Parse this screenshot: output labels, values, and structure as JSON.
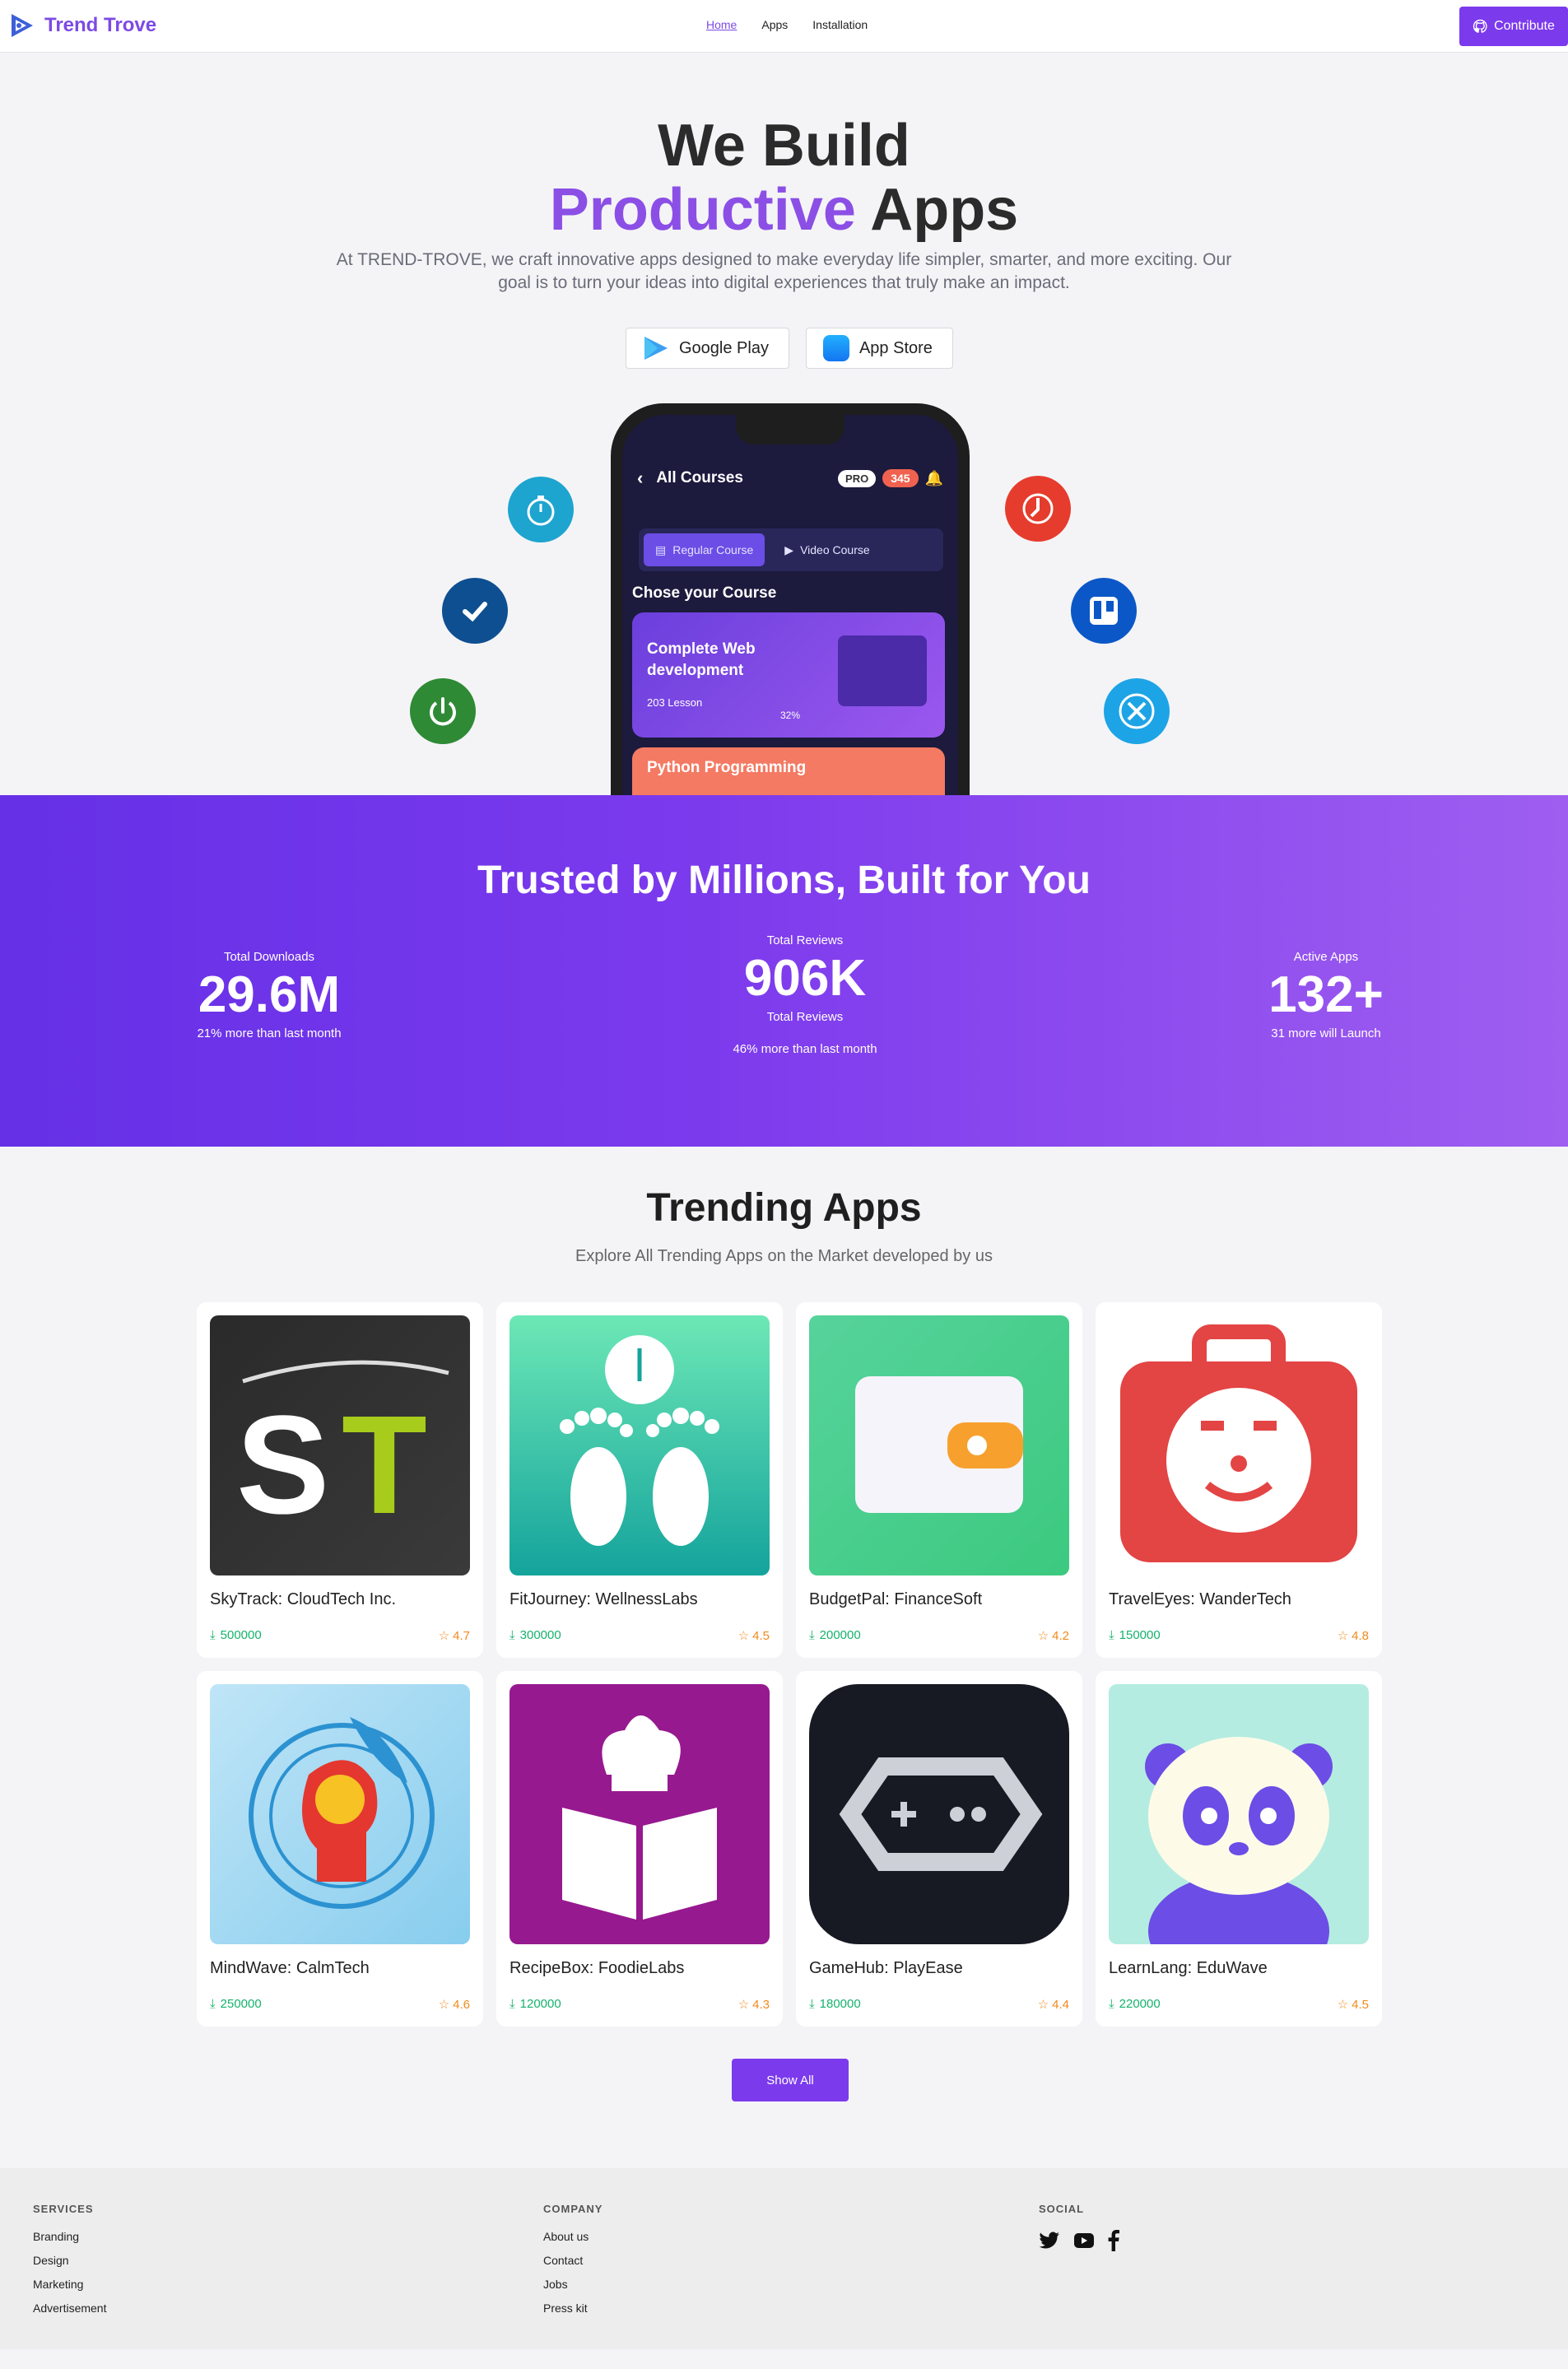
{
  "nav": {
    "brand": "Trend Trove",
    "links": [
      "Home",
      "Apps",
      "Installation"
    ],
    "contribute": "Contribute"
  },
  "hero": {
    "title_line1": "We Build",
    "title_accent": "Productive",
    "title_rest": "Apps",
    "subtitle": "At TREND-TROVE, we craft innovative apps designed to make everyday life simpler, smarter, and more exciting. Our goal is to turn your ideas into digital experiences that truly make an impact.",
    "google_play": "Google Play",
    "app_store": "App Store"
  },
  "phone": {
    "header": "All Courses",
    "pro": "PRO",
    "coins": "345",
    "tab_regular": "Regular Course",
    "tab_video": "Video Course",
    "section": "Chose your Course",
    "course1_title": "Complete Web development",
    "course1_lessons": "203 Lesson",
    "course1_progress": "32%",
    "course2_title": "Python Programming"
  },
  "stats": {
    "title": "Trusted by Millions, Built for You",
    "items": [
      {
        "label": "Total Downloads",
        "value": "29.6M",
        "desc": "21% more than last month"
      },
      {
        "label": "Total Reviews",
        "value": "906K",
        "label2": "Total Reviews",
        "desc": "46% more than last month"
      },
      {
        "label": "Active Apps",
        "value": "132+",
        "desc": "31 more will Launch"
      }
    ]
  },
  "trending": {
    "title": "Trending Apps",
    "subtitle": "Explore All Trending Apps on the Market developed by us",
    "apps": [
      {
        "name": "SkyTrack: CloudTech Inc.",
        "downloads": "500000",
        "rating": "4.7"
      },
      {
        "name": "FitJourney: WellnessLabs",
        "downloads": "300000",
        "rating": "4.5"
      },
      {
        "name": "BudgetPal: FinanceSoft",
        "downloads": "200000",
        "rating": "4.2"
      },
      {
        "name": "TravelEyes: WanderTech",
        "downloads": "150000",
        "rating": "4.8"
      },
      {
        "name": "MindWave: CalmTech",
        "downloads": "250000",
        "rating": "4.6"
      },
      {
        "name": "RecipeBox: FoodieLabs",
        "downloads": "120000",
        "rating": "4.3"
      },
      {
        "name": "GameHub: PlayEase",
        "downloads": "180000",
        "rating": "4.4"
      },
      {
        "name": "LearnLang: EduWave",
        "downloads": "220000",
        "rating": "4.5"
      }
    ],
    "show_all": "Show All"
  },
  "footer": {
    "services_title": "SERVICES",
    "services": [
      "Branding",
      "Design",
      "Marketing",
      "Advertisement"
    ],
    "company_title": "COMPANY",
    "company": [
      "About us",
      "Contact",
      "Jobs",
      "Press kit"
    ],
    "social_title": "SOCIAL"
  },
  "colors": {
    "accent": "#7c3aed",
    "download": "#15b26b",
    "rating": "#f28a1c"
  }
}
